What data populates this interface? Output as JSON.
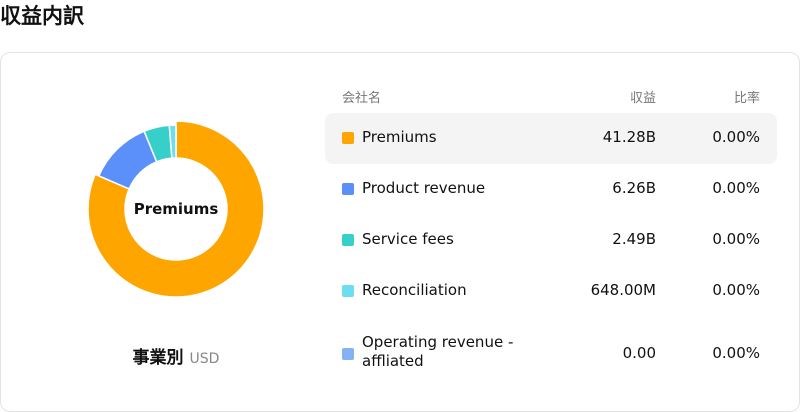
{
  "page": {
    "title": "収益内訳"
  },
  "chart": {
    "center_label": "Premiums",
    "breakdown_mode": "事業別",
    "currency": "USD"
  },
  "table": {
    "headers": {
      "company": "会社名",
      "revenue": "収益",
      "ratio": "比率"
    },
    "rows": [
      {
        "name": "Premiums",
        "revenue": "41.28B",
        "ratio": "0.00%",
        "color": "#FFA500",
        "value": 41.28
      },
      {
        "name": "Product revenue",
        "revenue": "6.26B",
        "ratio": "0.00%",
        "color": "#5B8FF9",
        "value": 6.26
      },
      {
        "name": "Service fees",
        "revenue": "2.49B",
        "ratio": "0.00%",
        "color": "#36CFC9",
        "value": 2.49
      },
      {
        "name": "Reconciliation",
        "revenue": "648.00M",
        "ratio": "0.00%",
        "color": "#6DDEF0",
        "value": 0.648
      },
      {
        "name": "Operating revenue - affliated",
        "revenue": "0.00",
        "ratio": "0.00%",
        "color": "#85B1F5",
        "value": 0
      }
    ]
  },
  "chart_data": {
    "type": "pie",
    "categories": [
      "Premiums",
      "Product revenue",
      "Service fees",
      "Reconciliation",
      "Operating revenue - affliated"
    ],
    "values": [
      41.28,
      6.26,
      2.49,
      0.648,
      0
    ],
    "colors": [
      "#FFA500",
      "#5B8FF9",
      "#36CFC9",
      "#6DDEF0",
      "#85B1F5"
    ]
  }
}
